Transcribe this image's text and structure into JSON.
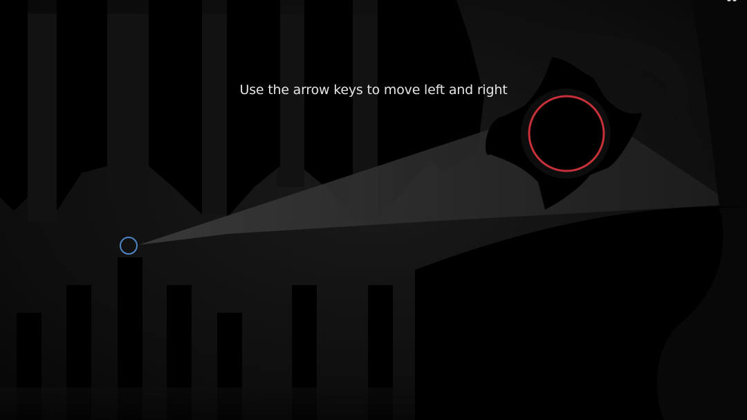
{
  "hud": {
    "instruction": "Use the arrow keys to move left and right"
  },
  "player": {
    "icon": "ring-icon",
    "color": "#4f86c6"
  },
  "target": {
    "icon": "red-ring-icon",
    "color": "#c8313a",
    "core_color": "#000000"
  },
  "corner_icon": "pause-icon",
  "colors": {
    "background": "#0b0b0b",
    "pillar": "#000000",
    "beam": "#6a6a6a",
    "text": "#e6e6e6"
  }
}
